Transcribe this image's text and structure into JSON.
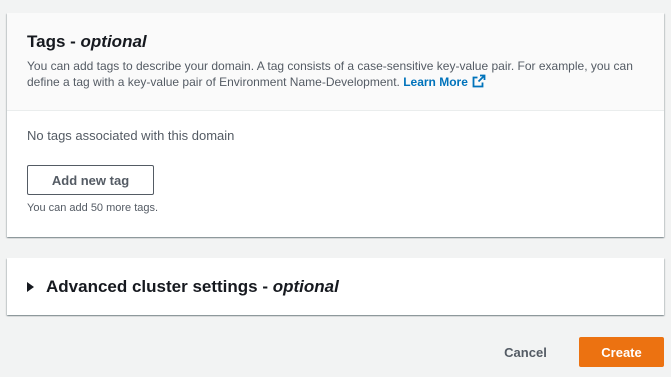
{
  "tags": {
    "title": "Tags - ",
    "title_optional": "optional",
    "description": "You can add tags to describe your domain. A tag consists of a case-sensitive key-value pair. For example, you can define a tag with a key-value pair of Environment Name-Development.",
    "learn_more": "Learn More",
    "learn_more_icon": "external-link-icon",
    "empty_text": "No tags associated with this domain",
    "add_button": "Add new tag",
    "hint": "You can add 50 more tags."
  },
  "advanced": {
    "title": "Advanced cluster settings - ",
    "title_optional": "optional",
    "icon": "caret-right-icon"
  },
  "footer": {
    "cancel": "Cancel",
    "create": "Create"
  },
  "colors": {
    "primary": "#ec7211",
    "link": "#0073bb",
    "background": "#f2f3f3"
  }
}
